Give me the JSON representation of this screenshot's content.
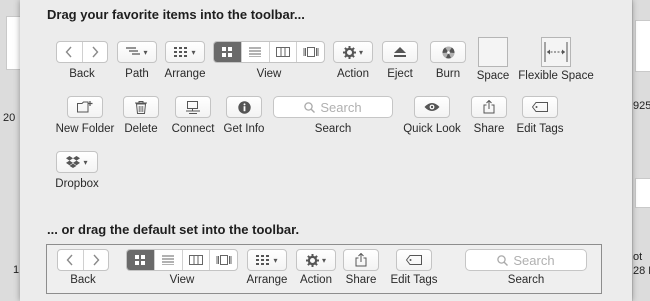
{
  "background": {
    "left_text_1": "20",
    "left_text_2": "1",
    "right_text_1": "925",
    "right_text_2": "ot",
    "right_text_3": "28 F"
  },
  "sheet": {
    "heading": "Drag your favorite items into the toolbar...",
    "default_heading": "... or drag the default set into the toolbar."
  },
  "items": {
    "back": "Back",
    "path": "Path",
    "arrange": "Arrange",
    "view": "View",
    "action": "Action",
    "eject": "Eject",
    "burn": "Burn",
    "space": "Space",
    "flexible_space": "Flexible Space",
    "new_folder": "New Folder",
    "delete": "Delete",
    "connect": "Connect",
    "get_info": "Get Info",
    "search": "Search",
    "search_placeholder": "Search",
    "quick_look": "Quick Look",
    "share": "Share",
    "edit_tags": "Edit Tags",
    "dropbox": "Dropbox"
  },
  "default_set": {
    "back": "Back",
    "view": "View",
    "arrange": "Arrange",
    "action": "Action",
    "share": "Share",
    "edit_tags": "Edit Tags",
    "search": "Search",
    "search_placeholder": "Search"
  },
  "colors": {
    "selected_segment": "#6a6a6a",
    "sheet_background": "#ececec"
  }
}
